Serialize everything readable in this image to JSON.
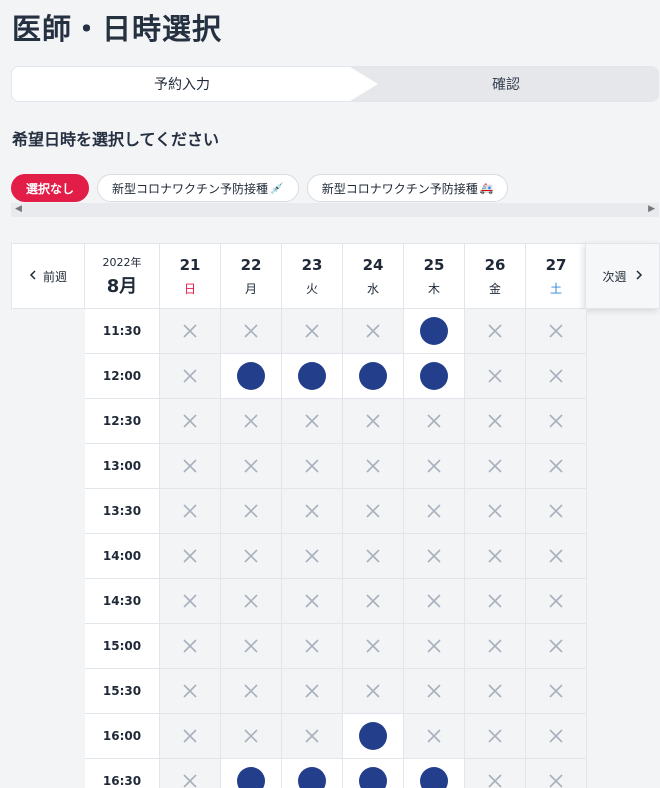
{
  "page_title": "医師・日時選択",
  "stepper": {
    "step1": "予約入力",
    "step2": "確認"
  },
  "subtitle": "希望日時を選択してください",
  "chips": [
    {
      "label": "選択なし",
      "emoji": "",
      "active": true
    },
    {
      "label": "新型コロナワクチン予防接種",
      "emoji": "💉",
      "active": false
    },
    {
      "label": "新型コロナワクチン予防接種",
      "emoji": "🚑",
      "active": false
    }
  ],
  "nav": {
    "prev": "前週",
    "next": "次週",
    "prev_icon": "chevron-left-icon",
    "next_icon": "chevron-right-icon"
  },
  "calendar": {
    "year": "2022年",
    "month": "8月",
    "days": [
      {
        "num": "21",
        "wd": "日",
        "type": "sun"
      },
      {
        "num": "22",
        "wd": "月",
        "type": ""
      },
      {
        "num": "23",
        "wd": "火",
        "type": ""
      },
      {
        "num": "24",
        "wd": "水",
        "type": ""
      },
      {
        "num": "25",
        "wd": "木",
        "type": ""
      },
      {
        "num": "26",
        "wd": "金",
        "type": ""
      },
      {
        "num": "27",
        "wd": "土",
        "type": "sat"
      }
    ],
    "slots": [
      {
        "time": "11:30",
        "avail": [
          0,
          0,
          0,
          0,
          1,
          0,
          0
        ]
      },
      {
        "time": "12:00",
        "avail": [
          0,
          1,
          1,
          1,
          1,
          0,
          0
        ]
      },
      {
        "time": "12:30",
        "avail": [
          0,
          0,
          0,
          0,
          0,
          0,
          0
        ]
      },
      {
        "time": "13:00",
        "avail": [
          0,
          0,
          0,
          0,
          0,
          0,
          0
        ]
      },
      {
        "time": "13:30",
        "avail": [
          0,
          0,
          0,
          0,
          0,
          0,
          0
        ]
      },
      {
        "time": "14:00",
        "avail": [
          0,
          0,
          0,
          0,
          0,
          0,
          0
        ]
      },
      {
        "time": "14:30",
        "avail": [
          0,
          0,
          0,
          0,
          0,
          0,
          0
        ]
      },
      {
        "time": "15:00",
        "avail": [
          0,
          0,
          0,
          0,
          0,
          0,
          0
        ]
      },
      {
        "time": "15:30",
        "avail": [
          0,
          0,
          0,
          0,
          0,
          0,
          0
        ]
      },
      {
        "time": "16:00",
        "avail": [
          0,
          0,
          0,
          1,
          0,
          0,
          0
        ]
      },
      {
        "time": "16:30",
        "avail": [
          0,
          1,
          1,
          1,
          1,
          0,
          0
        ]
      }
    ]
  },
  "colors": {
    "accent": "#e11d48",
    "available": "#233e8b",
    "unavailable": "#a9b1bd",
    "sunday": "#e11d48",
    "saturday": "#2b8ad8"
  }
}
